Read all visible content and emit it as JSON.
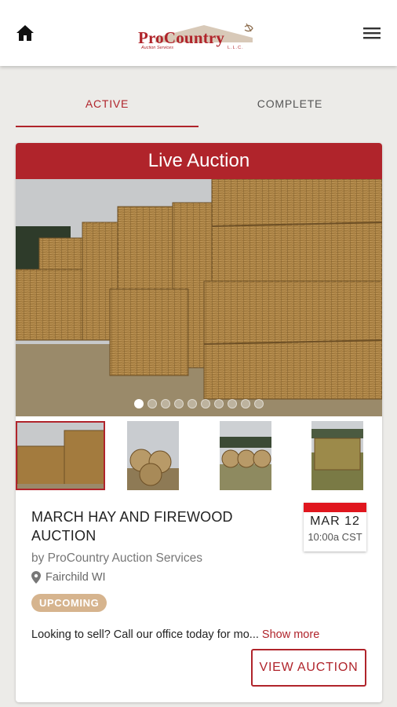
{
  "header": {
    "home_icon": "home-icon",
    "menu_icon": "hamburger-menu-icon",
    "logo": {
      "name": "ProCountry",
      "tagline": "Auction Services",
      "suffix": "L.L.C."
    }
  },
  "tabs": [
    {
      "label": "ACTIVE",
      "active": true
    },
    {
      "label": "COMPLETE",
      "active": false
    }
  ],
  "auction": {
    "banner": "Live Auction",
    "image_count": 10,
    "current_image": 1,
    "thumbnail_count": 4,
    "title": "MARCH HAY AND FIREWOOD AUCTION",
    "byline": "by ProCountry Auction Services",
    "location": "Fairchild WI",
    "status": "UPCOMING",
    "description": "Looking to sell? Call our office today for mo...",
    "show_more": "Show more",
    "date": {
      "month": "MAR",
      "day": "12",
      "time": "10:00a CST"
    },
    "cta": "VIEW AUCTION"
  },
  "colors": {
    "brand": "#b0242b",
    "date_band": "#e0161e",
    "badge": "#d6b48e"
  }
}
